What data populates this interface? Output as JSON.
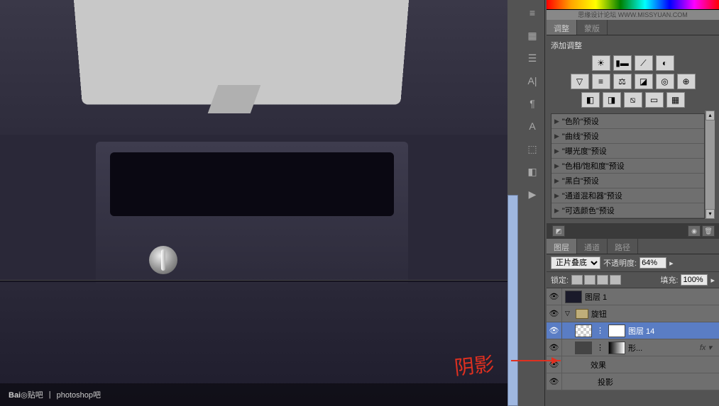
{
  "watermark": "思缘设计论坛  WWW.MISSYUAN.COM",
  "adjustments": {
    "tab1": "调整",
    "tab2": "蒙版",
    "title": "添加调整",
    "presets": [
      "\"色阶\"预设",
      "\"曲线\"预设",
      "\"曝光度\"预设",
      "\"色相/饱和度\"预设",
      "\"黑白\"预设",
      "\"通道混和器\"预设",
      "\"可选颜色\"预设"
    ]
  },
  "layers": {
    "tab1": "图层",
    "tab2": "通道",
    "tab3": "路径",
    "blend_mode": "正片叠底",
    "opacity_label": "不透明度:",
    "opacity_value": "64%",
    "lock_label": "锁定:",
    "fill_label": "填充:",
    "fill_value": "100%",
    "items": [
      {
        "name": "图层 1"
      },
      {
        "name": "旋钮"
      },
      {
        "name": "图层 14"
      },
      {
        "name": "形..."
      },
      {
        "name": "效果"
      },
      {
        "name": "投影"
      }
    ]
  },
  "annotation": "阴影",
  "footer": {
    "brand": "Bai",
    "brand2": "贴吧",
    "section": "photoshop吧"
  }
}
